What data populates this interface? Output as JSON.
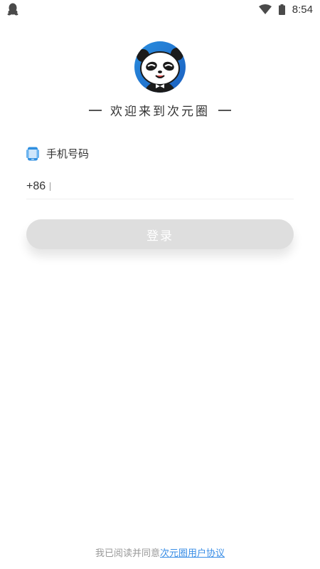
{
  "status_bar": {
    "time": "8:54",
    "icons": [
      "qq-icon",
      "wifi-icon",
      "battery-icon"
    ]
  },
  "logo": {
    "icon": "panda-avatar"
  },
  "welcome": {
    "text": "欢迎来到次元圈"
  },
  "phone": {
    "label": "手机号码",
    "country_code": "+86",
    "value": "",
    "placeholder": "",
    "icon": "phone-icon"
  },
  "login": {
    "label": "登录"
  },
  "agreement": {
    "prefix": "我已阅读并同意",
    "link": "次元圈用户协议"
  },
  "colors": {
    "accent": "#3a8ee6",
    "button_disabled": "#dedede",
    "text": "#333333",
    "muted": "#999999"
  }
}
